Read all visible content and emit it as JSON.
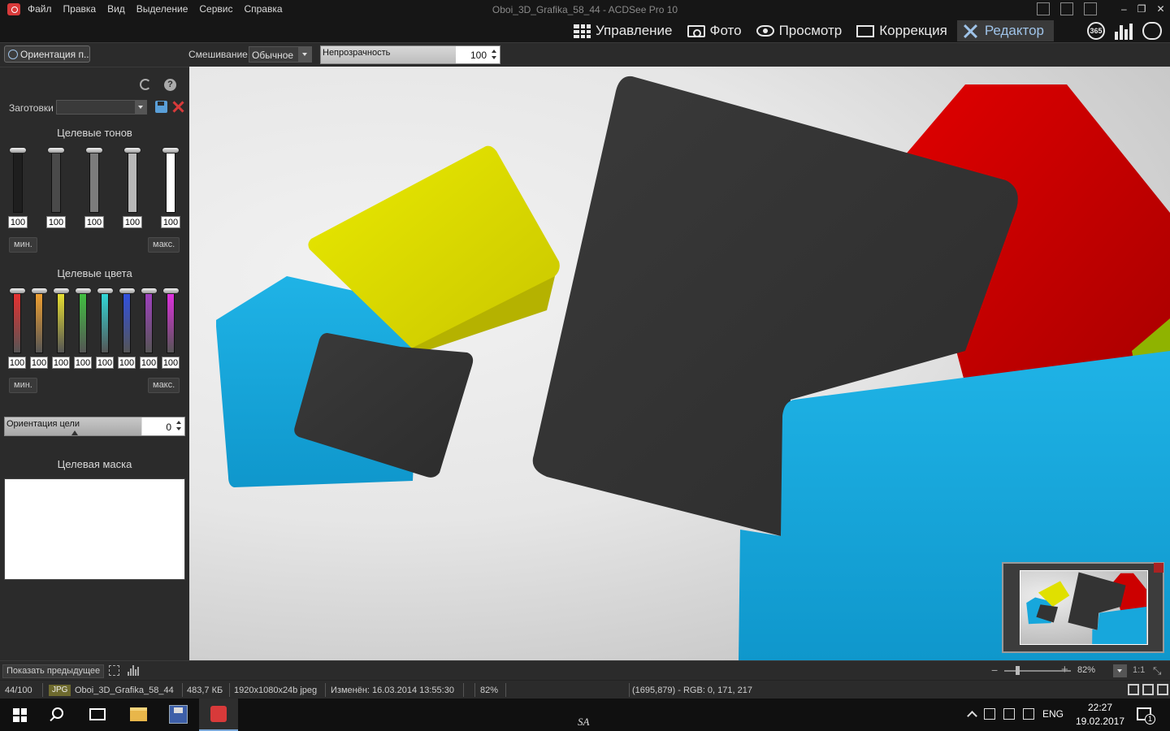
{
  "window": {
    "title": "Oboi_3D_Grafika_58_44 - ACDSee Pro 10",
    "menu": [
      "Файл",
      "Правка",
      "Вид",
      "Выделение",
      "Сервис",
      "Справка"
    ],
    "controls": [
      "–",
      "❐",
      "✕"
    ]
  },
  "modes": [
    {
      "label": "Управление",
      "icon": "grid-icon"
    },
    {
      "label": "Фото",
      "icon": "photo-icon"
    },
    {
      "label": "Просмотр",
      "icon": "eye-icon"
    },
    {
      "label": "Коррекция",
      "icon": "develop-icon"
    },
    {
      "label": "Редактор",
      "icon": "editor-icon",
      "active": true
    }
  ],
  "extra_modes": {
    "badge_365": "365"
  },
  "toolbar": {
    "tool_button": "Ориентация п...",
    "blend_label": "Смешивание:",
    "blend_value": "Обычное",
    "opacity_label": "Непрозрачность",
    "opacity_value": "100"
  },
  "panel": {
    "presets_label": "Заготовки",
    "tones_title": "Целевые тонов",
    "tones": [
      {
        "value": "100",
        "color": "#1e1e1e"
      },
      {
        "value": "100",
        "color": "#4a4a4a"
      },
      {
        "value": "100",
        "color": "#7c7c7c"
      },
      {
        "value": "100",
        "color": "#b8b8b8"
      },
      {
        "value": "100",
        "color": "#ffffff"
      }
    ],
    "min_label": "мин.",
    "max_label": "макс.",
    "colors_title": "Целевые цвета",
    "colors": [
      {
        "value": "100",
        "color": "#e83030"
      },
      {
        "value": "100",
        "color": "#f0a030"
      },
      {
        "value": "100",
        "color": "#e8e030"
      },
      {
        "value": "100",
        "color": "#40c040"
      },
      {
        "value": "100",
        "color": "#30d8d8"
      },
      {
        "value": "100",
        "color": "#3050e0"
      },
      {
        "value": "100",
        "color": "#a040c0"
      },
      {
        "value": "100",
        "color": "#e030e0"
      }
    ],
    "orientation_label": "Ориентация цели",
    "orientation_value": "0",
    "mask_title": "Целевая маска"
  },
  "bottom": {
    "show_previous": "Показать предыдущее",
    "zoom_minus": "−",
    "zoom_plus": "+",
    "zoom": "82%",
    "one_to_one": "1:1",
    "fit_glyph": "⤡"
  },
  "status": {
    "index": "44/100",
    "format": "JPG",
    "filename": "Oboi_3D_Grafika_58_44",
    "size": "483,7 КБ",
    "dimensions": "1920x1080x24b jpeg",
    "modified": "Изменён: 16.03.2014 13:55:30",
    "zoom": "82%",
    "pixel_info": "(1695,879) - RGB: 0, 171, 217"
  },
  "taskbar": {
    "center_label": "SA",
    "lang": "ENG",
    "time": "22:27",
    "date": "19.02.2017",
    "notifications": "1"
  },
  "colors": {
    "cyan": "#17a7dc",
    "yellow": "#e2e000",
    "dark": "#353535",
    "red": "#cc0000",
    "accent": "#9fc3e8"
  }
}
